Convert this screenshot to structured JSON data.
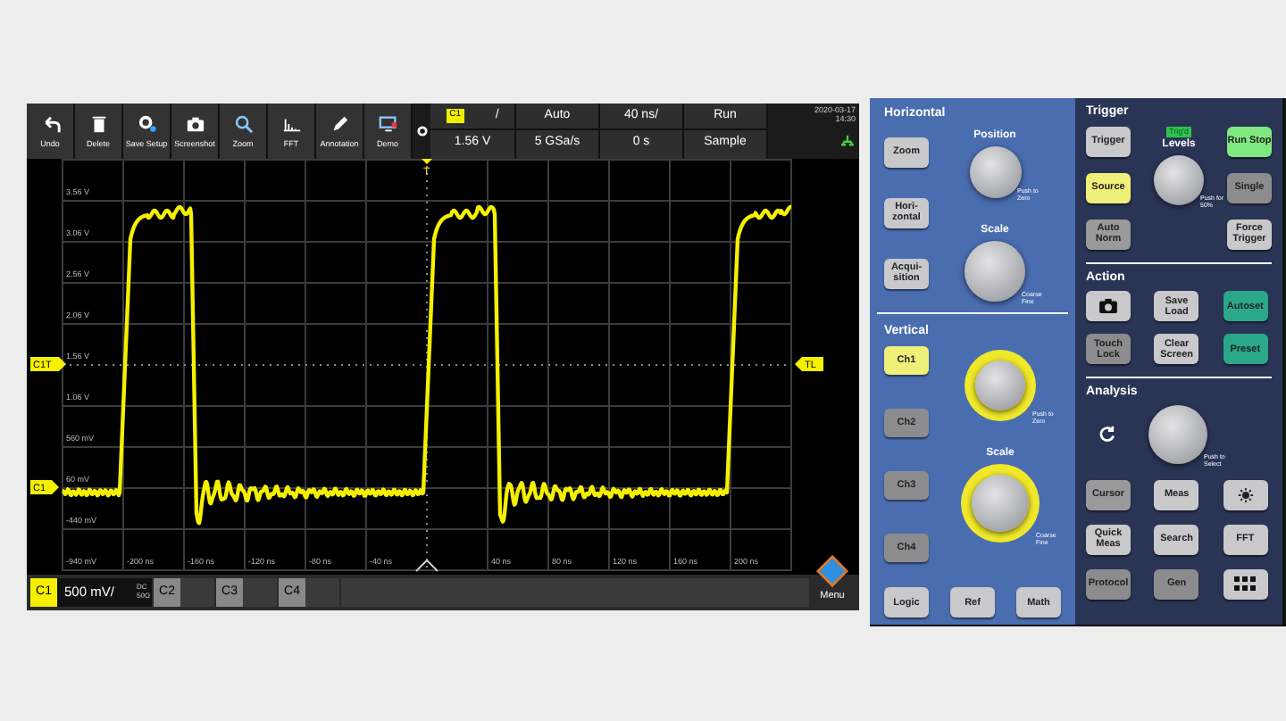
{
  "toolbar": {
    "buttons": [
      {
        "label": "Undo"
      },
      {
        "label": "Delete"
      },
      {
        "label": "Save Setup"
      },
      {
        "label": "Screenshot"
      },
      {
        "label": "Zoom"
      },
      {
        "label": "FFT"
      },
      {
        "label": "Annotation"
      },
      {
        "label": "Demo"
      }
    ]
  },
  "status": {
    "channel": "C1",
    "slope": "/",
    "level": "1.56 V",
    "mode": "Auto",
    "sample_rate": "5 GSa/s",
    "timebase": "40 ns/",
    "position": "0 s",
    "run_state": "Run",
    "acquisition": "Sample",
    "date": "2020-03-17",
    "time": "14:30"
  },
  "display": {
    "y_labels": [
      "3.56 V",
      "3.06 V",
      "2.56 V",
      "2.06 V",
      "1.56 V",
      "1.06 V",
      "560 mV",
      "60 mV",
      "-440 mV",
      "-940 mV"
    ],
    "x_labels": [
      "-200 ns",
      "-160 ns",
      "-120 ns",
      "-80 ns",
      "-40 ns",
      "40 ns",
      "80 ns",
      "120 ns",
      "160 ns",
      "200 ns"
    ],
    "markers": [
      {
        "kind": "trigger_channel",
        "label": "C1T"
      },
      {
        "kind": "channel_offset",
        "label": "C1"
      },
      {
        "kind": "trigger_level",
        "label": "TL"
      },
      {
        "kind": "trigger_position",
        "label": "T"
      }
    ]
  },
  "channel_bar": {
    "channels": [
      {
        "label": "C1",
        "selected": true,
        "scale": "500 mV/",
        "coupling": "DC",
        "impedance": "50Ω"
      },
      {
        "label": "C2",
        "selected": false
      },
      {
        "label": "C3",
        "selected": false
      },
      {
        "label": "C4",
        "selected": false
      }
    ],
    "menu": "Menu"
  },
  "horizontal": {
    "title": "Horizontal",
    "buttons": [
      {
        "label": "Zoom",
        "color": "#c9c9cc"
      },
      {
        "label": "Hori-zontal",
        "color": "#c9c9cc"
      },
      {
        "label": "Acqui-sition",
        "color": "#c9c9cc"
      }
    ],
    "knobs": [
      {
        "title": "Position",
        "hint": "Push to Zero",
        "ring": false
      },
      {
        "title": "Scale",
        "hint": "Coarse Fine",
        "ring": false
      }
    ]
  },
  "vertical": {
    "title": "Vertical",
    "buttons": [
      {
        "label": "Ch1",
        "color": "#eef07a"
      },
      {
        "label": "Ch2",
        "color": "#8c8c8e"
      },
      {
        "label": "Ch3",
        "color": "#8c8c8e"
      },
      {
        "label": "Ch4",
        "color": "#8c8c8e"
      }
    ],
    "knobs": [
      {
        "hint": "Push to Zero",
        "ring": true
      },
      {
        "title": "Scale",
        "hint": "Coarse Fine",
        "ring": true
      }
    ],
    "bottom_buttons": [
      {
        "label": "Logic",
        "color": "#c9c9cc"
      },
      {
        "label": "Ref",
        "color": "#c9c9cc"
      },
      {
        "label": "Math",
        "color": "#c9c9cc"
      }
    ]
  },
  "trigger": {
    "title": "Trigger",
    "badge": "Trig'd",
    "knob": {
      "title": "Levels",
      "hint": "Push for 50%"
    },
    "left_buttons": [
      {
        "label": "Trigger",
        "color": "#c9c9cc"
      },
      {
        "label": "Source",
        "color": "#eef07a"
      },
      {
        "label": "Auto Norm",
        "color": "#9a9a9c"
      }
    ],
    "right_buttons": [
      {
        "label": "Run Stop",
        "color": "#7fe87f"
      },
      {
        "label": "Single",
        "color": "#8c8c8e"
      },
      {
        "label": "Force Trigger",
        "color": "#c9c9cc"
      }
    ]
  },
  "action": {
    "title": "Action",
    "buttons": [
      {
        "kind": "icon",
        "color": "#c9c9cc"
      },
      {
        "kind": "text",
        "label": "Save Load",
        "color": "#c9c9cc"
      },
      {
        "kind": "text",
        "label": "Autoset",
        "color": "#2aa889"
      },
      {
        "kind": "text",
        "label": "Touch Lock",
        "color": "#8c8c8e"
      },
      {
        "kind": "text",
        "label": "Clear Screen",
        "color": "#c9c9cc"
      },
      {
        "kind": "text",
        "label": "Preset",
        "color": "#2aa889"
      }
    ]
  },
  "analysis": {
    "title": "Analysis",
    "knob": {
      "hint": "Push to Select"
    },
    "buttons": [
      {
        "kind": "text",
        "label": "Cursor",
        "color": "#9a9a9c"
      },
      {
        "kind": "text",
        "label": "Meas",
        "color": "#c9c9cc"
      },
      {
        "kind": "icon",
        "color": "#c9c9cc"
      },
      {
        "kind": "text",
        "label": "Quick Meas",
        "color": "#c9c9cc"
      },
      {
        "kind": "text",
        "label": "Search",
        "color": "#c9c9cc"
      },
      {
        "kind": "text",
        "label": "FFT",
        "color": "#c9c9cc"
      },
      {
        "kind": "text",
        "label": "Protocol",
        "color": "#8c8c8e"
      },
      {
        "kind": "text",
        "label": "Gen",
        "color": "#8c8c8e"
      },
      {
        "kind": "icon",
        "color": "#c9c9cc"
      }
    ]
  }
}
